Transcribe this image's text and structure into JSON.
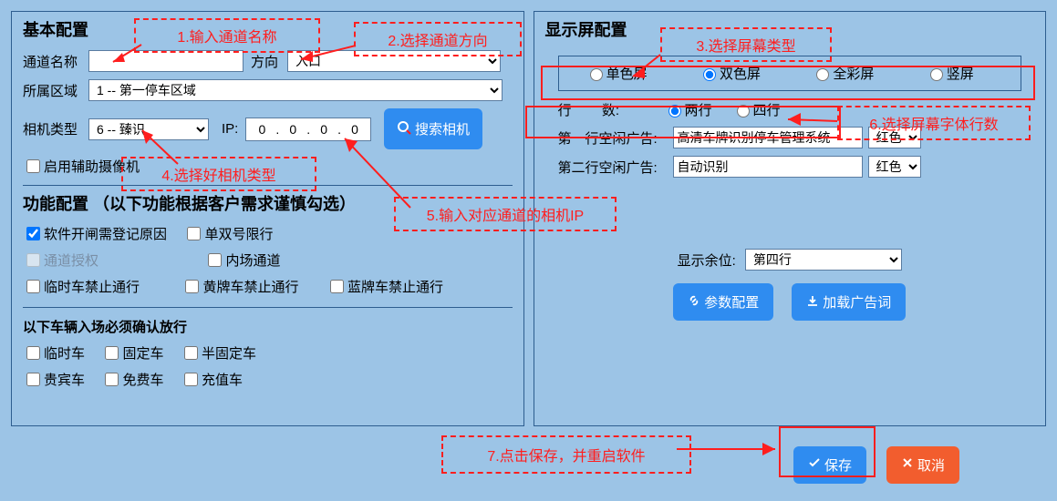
{
  "left": {
    "title": "基本配置",
    "channel_name_label": "通道名称",
    "channel_name_value": "",
    "direction_label": "方向",
    "direction_value": "入口",
    "region_label": "所属区域",
    "region_value": "1 -- 第一停车区域",
    "camera_type_label": "相机类型",
    "camera_type_value": "6 -- 臻识",
    "ip_label": "IP:",
    "ip": {
      "o1": "0",
      "o2": "0",
      "o3": "0",
      "o4": "0"
    },
    "search_camera": "搜索相机",
    "enable_aux": "启用辅助摄像机",
    "func_title": "功能配置 （以下功能根据客户需求谨慎勾选）",
    "func": {
      "open_need_reg": "软件开闸需登记原因",
      "odd_even": "单双号限行",
      "channel_auth": "通道授权",
      "inner_channel": "内场通道",
      "temp_forbid": "临时车禁止通行",
      "yellow_forbid": "黄牌车禁止通行",
      "blue_forbid": "蓝牌车禁止通行"
    },
    "confirm_title": "以下车辆入场必须确认放行",
    "veh": {
      "temp": "临时车",
      "fixed": "固定车",
      "half": "半固定车",
      "vip": "贵宾车",
      "free": "免费车",
      "value": "充值车"
    }
  },
  "right": {
    "title": "显示屏配置",
    "screen_types": {
      "mono": "单色屏",
      "dual": "双色屏",
      "color": "全彩屏",
      "vert": "竖屏"
    },
    "rows_label": "行        数:",
    "row_opts": {
      "two": "两行",
      "four": "四行"
    },
    "ad1_label": "第一行空闲广告:",
    "ad1_value": "高清车牌识别停车管理系统",
    "ad2_label": "第二行空闲广告:",
    "ad2_value": "自动识别",
    "color_value": "红色",
    "show_remain_label": "显示余位:",
    "show_remain_value": "第四行",
    "param_cfg": "参数配置",
    "load_ad": "加载广告词"
  },
  "bottom": {
    "save": "保存",
    "cancel": "取消"
  },
  "annot": {
    "a1": "1.输入通道名称",
    "a2": "2.选择通道方向",
    "a3": "3.选择屏幕类型",
    "a4": "4.选择好相机类型",
    "a5": "5.输入对应通道的相机IP",
    "a6": "6.选择屏幕字体行数",
    "a7": "7.点击保存，并重启软件"
  }
}
